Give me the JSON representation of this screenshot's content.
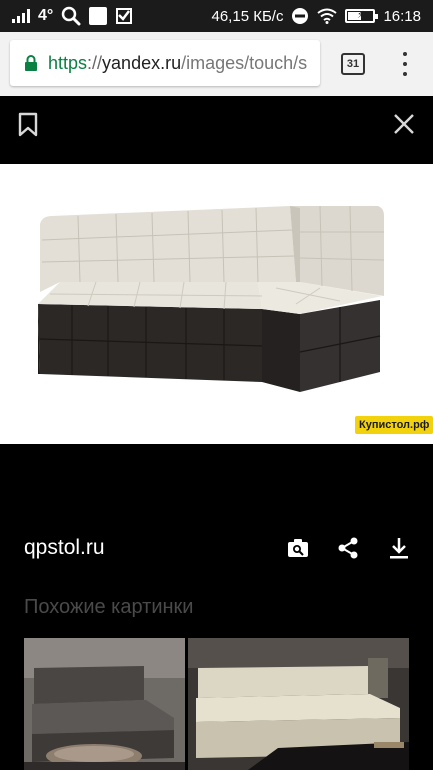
{
  "status_bar": {
    "network": "4°",
    "speed": "46,15 КБ/с",
    "time": "16:18",
    "battery_level": 0.55
  },
  "browser": {
    "url_scheme": "https",
    "url_separator": "://",
    "url_domain": "yandex.ru",
    "url_path": "/images/touch/s",
    "tab_count": "31",
    "secure_color": "#0b8043"
  },
  "viewer": {
    "watermark": "Купистол.рф",
    "source": "qpstol.ru",
    "similar_title": "Похожие картинки",
    "actions": [
      "search-by-image-icon",
      "share-icon",
      "download-icon"
    ]
  },
  "colors": {
    "background": "#000000",
    "status_bar": "#1b1b1b",
    "url_bar": "#f2f2f2",
    "sofa_fabric": "#e6e3da",
    "sofa_base": "#2b2826",
    "watermark_bg": "#f2d20c"
  }
}
